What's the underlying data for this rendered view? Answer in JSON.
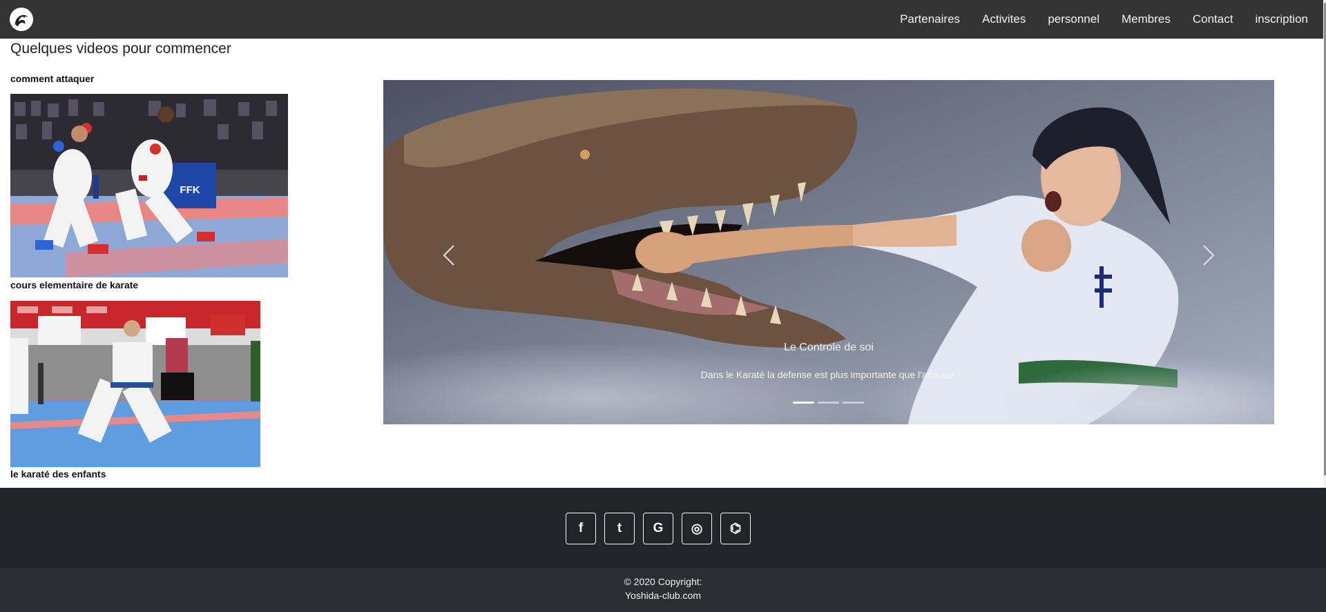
{
  "nav": {
    "brand_icon": "dragon-logo-icon",
    "links": [
      "Partenaires",
      "Activites",
      "personnel",
      "Membres",
      "Contact",
      "inscription"
    ]
  },
  "main": {
    "section_title": "Quelques videos pour commencer",
    "videos": [
      {
        "title": "comment attaquer"
      },
      {
        "title": "cours elementaire de karate"
      },
      {
        "title": "le karaté des enfants"
      }
    ]
  },
  "carousel": {
    "caption_title": "Le Controle de soi",
    "caption_text": "Dans le Karaté la defense est plus importante que l'attaque.",
    "slide_count": 3,
    "active_index": 0,
    "prev_icon": "chevron-left-icon",
    "next_icon": "chevron-right-icon"
  },
  "footer": {
    "social": [
      {
        "icon": "facebook-icon",
        "glyph": "f"
      },
      {
        "icon": "twitter-icon",
        "glyph": "t"
      },
      {
        "icon": "google-icon",
        "glyph": "G"
      },
      {
        "icon": "instagram-icon",
        "glyph": "◎"
      },
      {
        "icon": "github-icon",
        "glyph": "⌬"
      }
    ],
    "copyright_line1": "© 2020 Copyright:",
    "copyright_line2": "Yoshida-club.com"
  },
  "colors": {
    "navbar_bg": "#343434",
    "footer_bg": "#212529",
    "copyright_bg": "#2a2d31"
  }
}
